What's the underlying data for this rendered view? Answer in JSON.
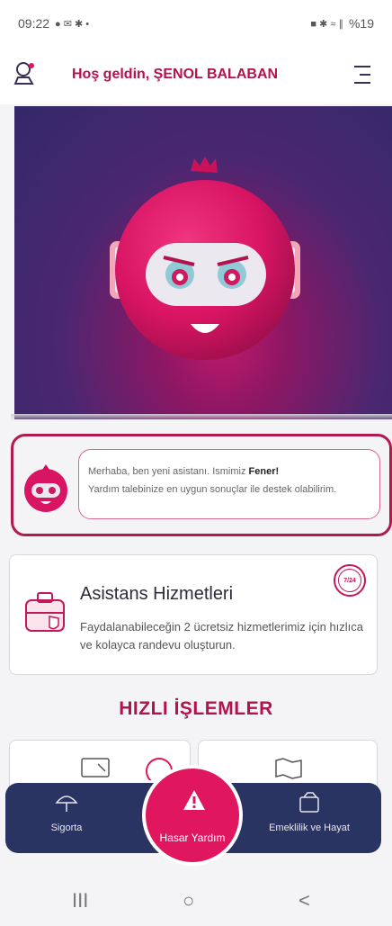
{
  "status_bar": {
    "time": "09:22",
    "left_icons": "● ✉ ✱ •",
    "right_icons": "■ ✱ ≈ ∥",
    "battery": "%19"
  },
  "header": {
    "welcome": "Hoş geldin, ŞENOL BALABAN"
  },
  "assistant": {
    "line1_prefix": "Merhaba, ben yeni asistanı. Ismimiz ",
    "name": "Fener!",
    "line2": "Yardım talebinize en uygun sonuçlar ile destek olabilirim."
  },
  "asistans_card": {
    "title": "Asistans Hizmetleri",
    "description": "Faydalanabileceğin 2 ücretsiz hizmetlerimiz için hızlıca ve kolayca randevu oluşturun.",
    "badge": "7/24"
  },
  "quick_actions": {
    "title": "HIZLI İŞLEMLER"
  },
  "bottom_nav": {
    "sigorta": "Sigorta",
    "hasar": "Hasar Yardım",
    "emeklilik": "Emeklilik ve Hayat"
  },
  "system_nav": {
    "recent": "III",
    "home": "○",
    "back": "<"
  },
  "colors": {
    "brand": "#b2134f",
    "nav_bg": "#2a3463",
    "fab": "#e0175f"
  }
}
